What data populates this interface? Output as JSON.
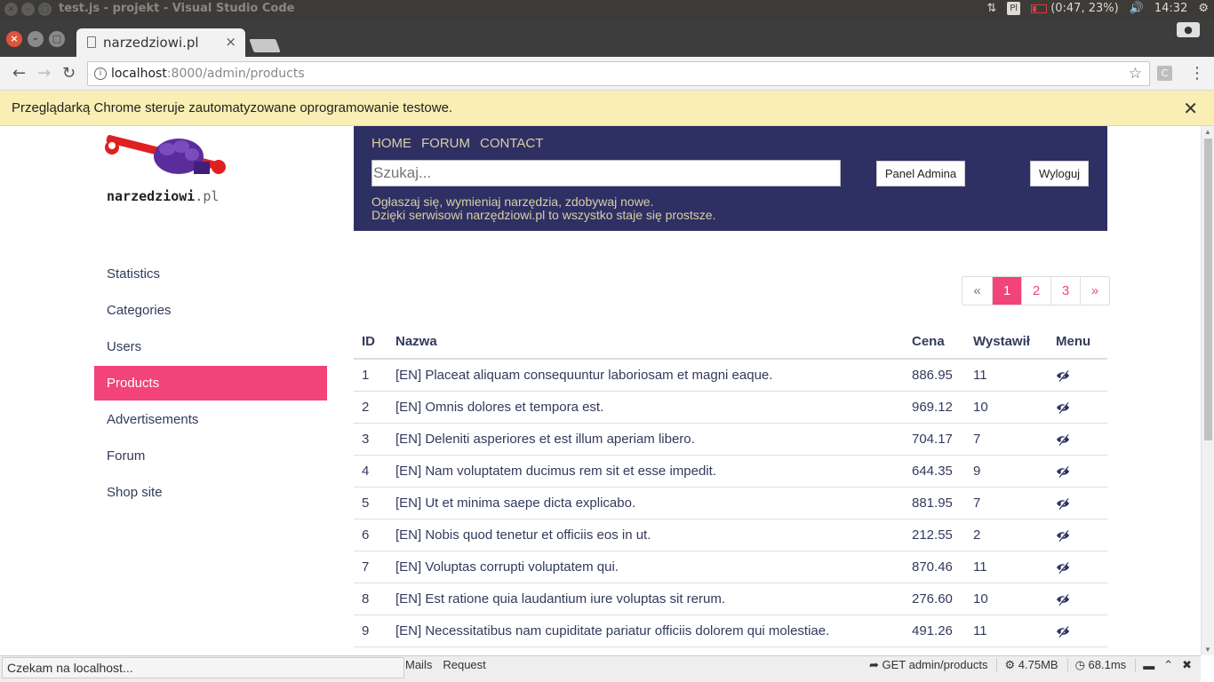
{
  "os": {
    "window_title": "test.js - projekt - Visual Studio Code",
    "keyboard": "Pl",
    "battery": "(0:47, 23%)",
    "clock": "14:32"
  },
  "browser": {
    "tab_title": "narzedziowi.pl",
    "url_host": "localhost",
    "url_rest": ":8000/admin/products",
    "ext_label": "C",
    "automation_notice": "Przeglądarką Chrome steruje zautomatyzowane oprogramowanie testowe."
  },
  "site": {
    "logo_text": "narzedziowi",
    "logo_suffix": ".pl",
    "nav": [
      "HOME",
      "FORUM",
      "CONTACT"
    ],
    "search_placeholder": "Szukaj...",
    "admin_button": "Panel Admina",
    "logout_button": "Wyloguj",
    "tagline_1": "Ogłaszaj się, wymieniaj narzędzia, zdobywaj nowe.",
    "tagline_2": "Dzięki serwisowi narzędziowi.pl to wszystko staje się prostsze."
  },
  "sidebar": {
    "items": [
      "Statistics",
      "Categories",
      "Users",
      "Products",
      "Advertisements",
      "Forum",
      "Shop site"
    ],
    "active": "Products"
  },
  "pager": {
    "prev": "«",
    "pages": [
      "1",
      "2",
      "3"
    ],
    "next": "»",
    "current": "1"
  },
  "table": {
    "headers": [
      "ID",
      "Nazwa",
      "Cena",
      "Wystawił",
      "Menu"
    ],
    "rows": [
      {
        "id": "1",
        "name": "[EN] Placeat aliquam consequuntur laboriosam et magni eaque.",
        "price": "886.95",
        "by": "11"
      },
      {
        "id": "2",
        "name": "[EN] Omnis dolores et tempora est.",
        "price": "969.12",
        "by": "10"
      },
      {
        "id": "3",
        "name": "[EN] Deleniti asperiores et est illum aperiam libero.",
        "price": "704.17",
        "by": "7"
      },
      {
        "id": "4",
        "name": "[EN] Nam voluptatem ducimus rem sit et esse impedit.",
        "price": "644.35",
        "by": "9"
      },
      {
        "id": "5",
        "name": "[EN] Ut et minima saepe dicta explicabo.",
        "price": "881.95",
        "by": "7"
      },
      {
        "id": "6",
        "name": "[EN] Nobis quod tenetur et officiis eos in ut.",
        "price": "212.55",
        "by": "2"
      },
      {
        "id": "7",
        "name": "[EN] Voluptas corrupti voluptatem qui.",
        "price": "870.46",
        "by": "11"
      },
      {
        "id": "8",
        "name": "[EN] Est ratione quia laudantium iure voluptas sit rerum.",
        "price": "276.60",
        "by": "10"
      },
      {
        "id": "9",
        "name": "[EN] Necessitatibus nam cupiditate pariatur officiis dolorem qui molestiae.",
        "price": "491.26",
        "by": "11"
      }
    ]
  },
  "status_bubble": "Czekam na localhost...",
  "debugbar": {
    "tabs": [
      "Mails",
      "Request"
    ],
    "route": "GET admin/products",
    "memory": "4.75MB",
    "time": "68.1ms"
  },
  "colors": {
    "header_bg": "#2e3063",
    "accent": "#f2437a",
    "nav_text": "#d9cfa6"
  }
}
